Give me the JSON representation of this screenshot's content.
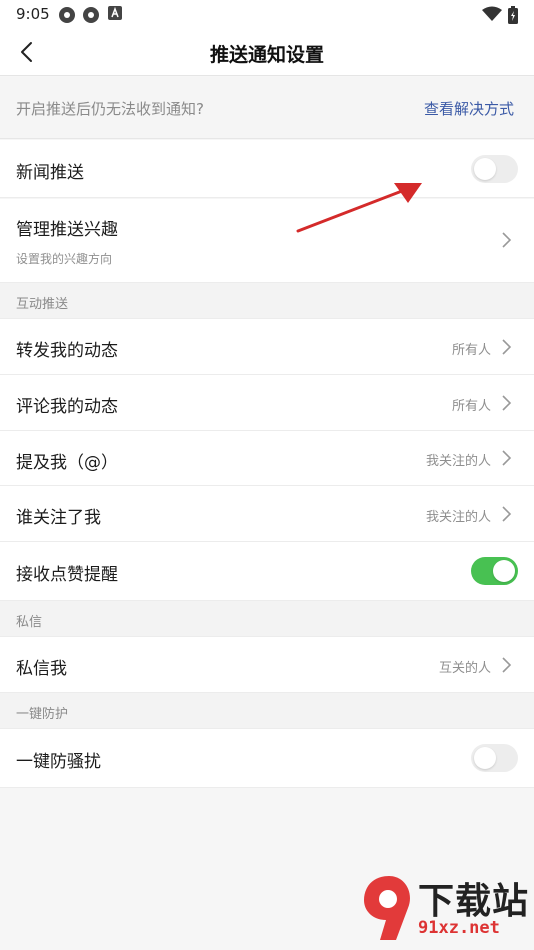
{
  "status_bar": {
    "time": "9:05",
    "icons": [
      "circle-icon",
      "circle-icon",
      "a-box-icon"
    ],
    "right_icons": [
      "wifi-icon",
      "battery-charging-icon"
    ]
  },
  "header": {
    "title": "推送通知设置",
    "back_icon": "chevron-left-icon"
  },
  "help": {
    "text": "开启推送后仍无法收到通知?",
    "link": "查看解决方式",
    "link_color": "#3b5aa6"
  },
  "news_push": {
    "label": "新闻推送",
    "enabled": false
  },
  "interest": {
    "label": "管理推送兴趣",
    "sub": "设置我的兴趣方向"
  },
  "sections": {
    "interaction": {
      "title": "互动推送",
      "items": [
        {
          "label": "转发我的动态",
          "value": "所有人"
        },
        {
          "label": "评论我的动态",
          "value": "所有人"
        },
        {
          "label": "提及我（@）",
          "value": "我关注的人"
        },
        {
          "label": "谁关注了我",
          "value": "我关注的人"
        }
      ],
      "like_reminder": {
        "label": "接收点赞提醒",
        "enabled": true
      }
    },
    "private_msg": {
      "title": "私信",
      "items": [
        {
          "label": "私信我",
          "value": "互关的人"
        }
      ]
    },
    "protection": {
      "title": "一键防护",
      "toggle": {
        "label": "一键防骚扰",
        "enabled": false
      }
    }
  },
  "colors": {
    "toggle_on": "#48c152",
    "toggle_off": "#ededed",
    "annotation_arrow": "#d42a2a"
  },
  "watermark": {
    "text": "下载站",
    "url": "91xz.net",
    "logo_text": "9"
  }
}
